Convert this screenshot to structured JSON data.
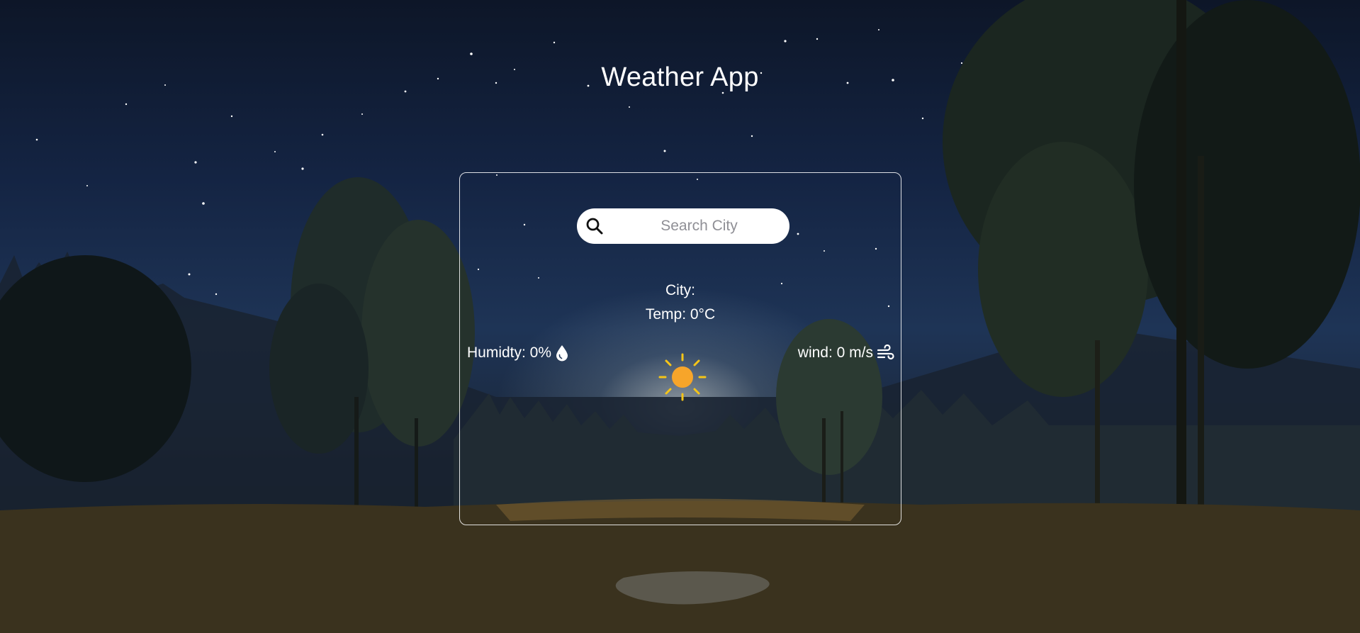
{
  "header": {
    "title": "Weather App"
  },
  "search": {
    "placeholder": "Search City",
    "icon": "search-icon"
  },
  "weather": {
    "city_label": "City:",
    "temp_label": "Temp: 0°C",
    "humidity_label": "Humidty: 0%",
    "humidity_icon": "droplet-icon",
    "wind_label": "wind: 0 m/s",
    "wind_icon": "wind-icon",
    "condition_icon": "sun-icon"
  },
  "colors": {
    "sky_top": "#0d1628",
    "sky_mid": "#1e3456",
    "sun": "#f7a52a",
    "sun_rays": "#f5c518",
    "text": "#ffffff",
    "placeholder": "#8f8f95"
  }
}
